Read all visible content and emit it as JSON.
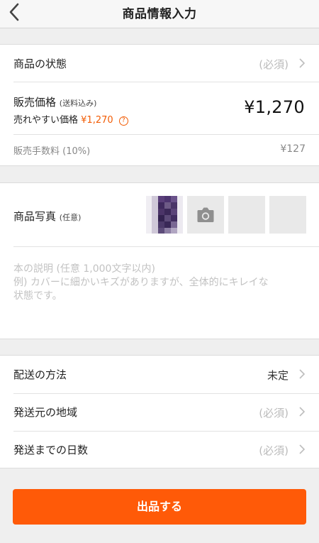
{
  "header": {
    "title": "商品情報入力",
    "back_icon": "chevron-left-icon"
  },
  "condition": {
    "label": "商品の状態",
    "value": "(必須)"
  },
  "price": {
    "label": "販売価格",
    "label_note": "(送料込み)",
    "easy_label": "売れやすい価格",
    "easy_value": "¥1,270",
    "help_icon": "?",
    "value": "¥1,270"
  },
  "fee": {
    "label": "販売手数料 (10%)",
    "value": "¥127"
  },
  "photos": {
    "label": "商品写真",
    "label_note": "(任意)",
    "camera_icon": "camera-icon"
  },
  "description": {
    "line1": "本の説明 (任意 1,000文字以内)",
    "line2": "例) カバーに細かいキズがありますが、全体的にキレイな",
    "line3": "状態です。"
  },
  "shipping": {
    "method": {
      "label": "配送の方法",
      "value": "未定"
    },
    "origin": {
      "label": "発送元の地域",
      "value": "(必須)"
    },
    "days": {
      "label": "発送までの日数",
      "value": "(必須)"
    }
  },
  "submit": {
    "label": "出品する"
  },
  "colors": {
    "accent": "#ff5a08",
    "price_accent": "#f25c05",
    "background": "#efefef"
  }
}
